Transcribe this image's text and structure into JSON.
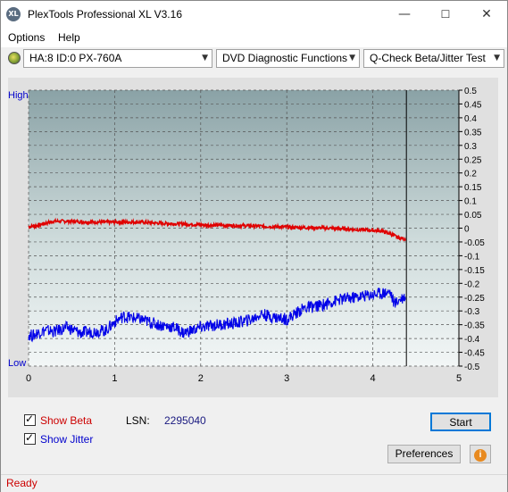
{
  "window": {
    "title": "PlexTools Professional XL V3.16",
    "app_icon_text": "XL"
  },
  "menu": {
    "options": "Options",
    "help": "Help"
  },
  "toolbar": {
    "drive": "HA:8 ID:0  PX-760A",
    "function": "DVD Diagnostic Functions",
    "test": "Q-Check Beta/Jitter Test"
  },
  "chart_data": {
    "type": "line",
    "left_axis": {
      "top_label": "High",
      "bottom_label": "Low"
    },
    "x": {
      "ticks": [
        "0",
        "1",
        "2",
        "3",
        "4",
        "5"
      ],
      "range": [
        0,
        5
      ]
    },
    "y_right": {
      "range": [
        -0.5,
        0.5
      ],
      "ticks": [
        "0.5",
        "0.45",
        "0.4",
        "0.35",
        "0.3",
        "0.25",
        "0.2",
        "0.15",
        "0.1",
        "0.05",
        "0",
        "-0.05",
        "-0.1",
        "-0.15",
        "-0.2",
        "-0.25",
        "-0.3",
        "-0.35",
        "-0.4",
        "-0.45",
        "-0.5"
      ]
    },
    "end_marker_x": 4.39,
    "grid": true,
    "series": [
      {
        "color": "#e00000",
        "x": [
          0,
          0.1,
          0.2,
          0.3,
          0.5,
          0.7,
          1.0,
          1.3,
          1.5,
          1.8,
          2.0,
          2.3,
          2.6,
          2.9,
          3.2,
          3.5,
          3.8,
          4.0,
          4.1,
          4.2,
          4.3,
          4.38
        ],
        "y": [
          0.005,
          0.01,
          0.018,
          0.025,
          0.025,
          0.022,
          0.022,
          0.022,
          0.018,
          0.015,
          0.012,
          0.01,
          0.008,
          0.005,
          0.002,
          0.0,
          -0.005,
          -0.008,
          -0.01,
          -0.02,
          -0.035,
          -0.04
        ]
      },
      {
        "color": "#0000e8",
        "x": [
          0,
          0.05,
          0.1,
          0.2,
          0.3,
          0.45,
          0.6,
          0.75,
          0.9,
          1.0,
          1.1,
          1.3,
          1.5,
          1.7,
          1.8,
          1.9,
          2.0,
          2.2,
          2.4,
          2.6,
          2.7,
          2.8,
          3.0,
          3.2,
          3.4,
          3.6,
          3.8,
          4.0,
          4.1,
          4.2,
          4.25,
          4.3,
          4.38
        ],
        "y": [
          -0.385,
          -0.39,
          -0.38,
          -0.37,
          -0.375,
          -0.36,
          -0.38,
          -0.375,
          -0.37,
          -0.34,
          -0.32,
          -0.33,
          -0.35,
          -0.36,
          -0.38,
          -0.37,
          -0.36,
          -0.35,
          -0.345,
          -0.33,
          -0.31,
          -0.32,
          -0.33,
          -0.29,
          -0.28,
          -0.26,
          -0.25,
          -0.24,
          -0.235,
          -0.23,
          -0.275,
          -0.26,
          -0.245
        ]
      }
    ]
  },
  "bottom": {
    "show_beta": "Show Beta",
    "show_jitter": "Show Jitter",
    "lsn_label": "LSN:",
    "lsn_value": "2295040",
    "start": "Start",
    "preferences": "Preferences",
    "info_icon": "i"
  },
  "status": {
    "text": "Ready"
  },
  "colors": {
    "beta": "#cc0000",
    "jitter": "#0000cc",
    "status": "#cc0000"
  }
}
